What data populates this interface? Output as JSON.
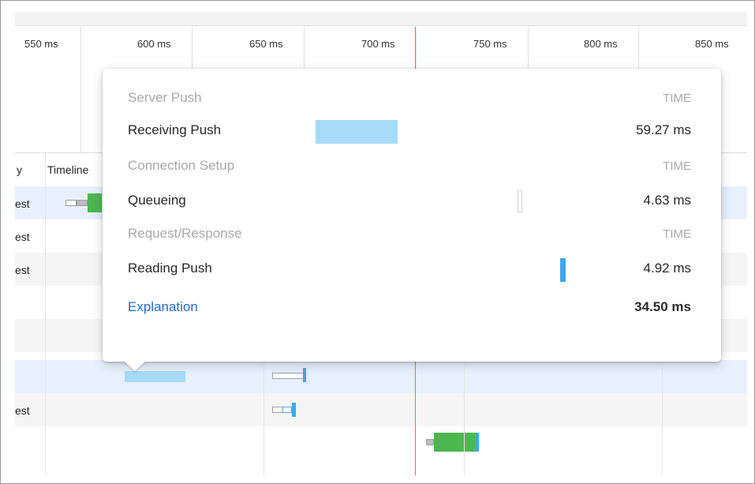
{
  "ruler": {
    "ticks": [
      "550 ms",
      "600 ms",
      "650 ms",
      "700 ms",
      "750 ms",
      "800 ms",
      "850 ms"
    ]
  },
  "grid": {
    "column_headers": {
      "partial_left": "y",
      "timeline": "Timeline"
    },
    "rows": [
      {
        "left_text": "est"
      },
      {
        "left_text": "est"
      },
      {
        "left_text": "est"
      },
      {
        "left_text": ""
      },
      {
        "left_text": ""
      },
      {
        "left_text": ""
      },
      {
        "left_text": "est"
      },
      {
        "left_text": ""
      }
    ]
  },
  "popover": {
    "sections": [
      {
        "title": "Server Push",
        "time_header": "TIME",
        "items": [
          {
            "label": "Receiving Push",
            "value": "59.27 ms"
          }
        ]
      },
      {
        "title": "Connection Setup",
        "time_header": "TIME",
        "items": [
          {
            "label": "Queueing",
            "value": "4.63 ms"
          }
        ]
      },
      {
        "title": "Request/Response",
        "time_header": "TIME",
        "items": [
          {
            "label": "Reading Push",
            "value": "4.92 ms"
          }
        ]
      }
    ],
    "explanation_link": "Explanation",
    "total": "34.50 ms"
  },
  "colors": {
    "receiving_push": "#a6daf7",
    "reading_push": "#3ea5ef",
    "queueing": "#ffffff",
    "green": "#4bb84f",
    "red_marker": "#e06c6c",
    "link": "#1f6ad8"
  }
}
